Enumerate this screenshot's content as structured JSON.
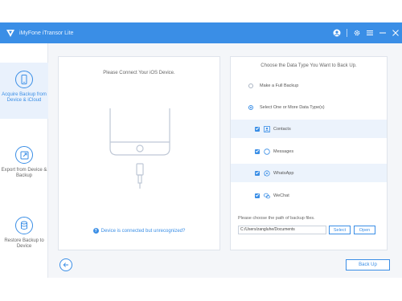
{
  "app": {
    "title": "iMyFone iTransor Lite",
    "accent": "#3a8ee6"
  },
  "window_controls": [
    {
      "name": "account-icon",
      "glyph": "👤"
    },
    {
      "name": "settings-icon",
      "glyph": "⚙"
    },
    {
      "name": "menu-icon",
      "glyph": "≡"
    },
    {
      "name": "minimize-icon",
      "glyph": "−"
    },
    {
      "name": "close-icon",
      "glyph": "✕"
    }
  ],
  "sidebar": {
    "items": [
      {
        "label": "Acquire Backup from Device & iCloud",
        "icon": "phone-backup-icon",
        "active": true
      },
      {
        "label": "Export from Device & Backup",
        "icon": "export-icon",
        "active": false
      },
      {
        "label": "Restore Backup to Device",
        "icon": "restore-icon",
        "active": false
      }
    ]
  },
  "left_panel": {
    "heading": "Please Connect Your iOS Device.",
    "status_link": "Device is connected but unrecognized?"
  },
  "right_panel": {
    "heading": "Choose the Data Type You Want to Back Up.",
    "options": {
      "full_backup": "Make a Full Backup",
      "select_types": "Select One or More Data Type(s)"
    },
    "data_types": [
      {
        "label": "Contacts",
        "icon": "contacts-icon",
        "checked": true
      },
      {
        "label": "Messages",
        "icon": "messages-icon",
        "checked": true
      },
      {
        "label": "WhatsApp",
        "icon": "whatsapp-icon",
        "checked": true
      },
      {
        "label": "WeChat",
        "icon": "wechat-icon",
        "checked": true
      }
    ],
    "path_label": "Please choose the path of backup files.",
    "path_value": "C:/Users/zangluhe/Documents",
    "select_label": "Select",
    "open_label": "Open"
  },
  "footer": {
    "back_up_label": "Back Up"
  }
}
